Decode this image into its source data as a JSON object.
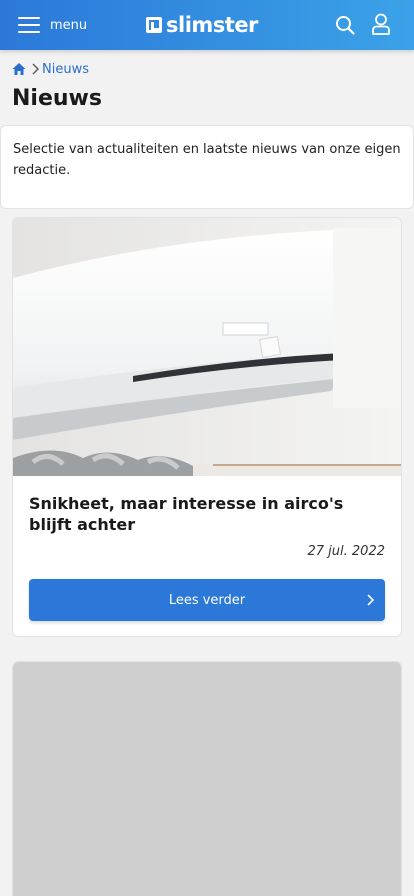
{
  "header": {
    "menu_label": "menu",
    "logo_text": "slimster",
    "icons": [
      "hamburger-icon",
      "logo-icon",
      "search-icon",
      "user-icon"
    ]
  },
  "breadcrumb": {
    "home_icon": "home-icon",
    "current": "Nieuws"
  },
  "page": {
    "title": "Nieuws",
    "intro": "Selectie van actualiteiten en laatste nieuws van onze eigen redactie."
  },
  "articles": [
    {
      "title": "Snikheet, maar interesse in airco's blijft achter",
      "date": "27 jul. 2022",
      "button_label": "Lees verder",
      "image": "air-conditioner-photo"
    },
    {
      "image": "article-photo-placeholder"
    }
  ],
  "colors": {
    "primary": "#2b78d8",
    "header_gradient_end": "#3ba2e8",
    "link": "#2a6fc9",
    "background": "#f2f2f2"
  }
}
